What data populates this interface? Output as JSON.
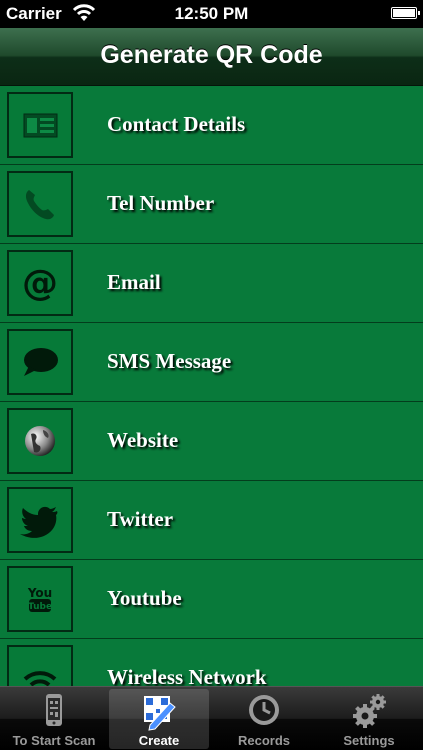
{
  "status_bar": {
    "carrier": "Carrier",
    "time": "12:50 PM"
  },
  "nav": {
    "title": "Generate QR Code"
  },
  "colors": {
    "row_background": "#087a3a",
    "nav_dark": "#0a2612"
  },
  "items": [
    {
      "label": "Contact Details",
      "icon": "contact-card-icon"
    },
    {
      "label": "Tel Number",
      "icon": "phone-icon"
    },
    {
      "label": "Email",
      "icon": "at-sign-icon"
    },
    {
      "label": "SMS Message",
      "icon": "speech-bubble-icon"
    },
    {
      "label": "Website",
      "icon": "globe-icon"
    },
    {
      "label": "Twitter",
      "icon": "twitter-bird-icon"
    },
    {
      "label": "Youtube",
      "icon": "youtube-icon"
    },
    {
      "label": "Wireless Network",
      "icon": "wifi-icon"
    }
  ],
  "tabs": [
    {
      "label": "To Start Scan",
      "icon": "phone-scan-icon",
      "selected": false
    },
    {
      "label": "Create",
      "icon": "qr-pen-icon",
      "selected": true
    },
    {
      "label": "Records",
      "icon": "clock-icon",
      "selected": false
    },
    {
      "label": "Settings",
      "icon": "gears-icon",
      "selected": false
    }
  ]
}
